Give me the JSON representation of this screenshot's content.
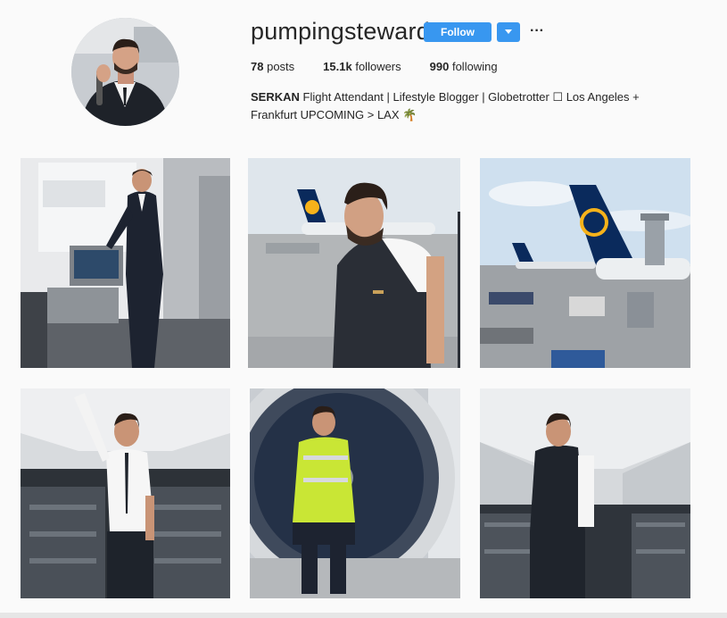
{
  "profile": {
    "username": "pumpingsteward",
    "follow_label": "Follow",
    "dropdown_icon": "chevron-down-icon",
    "more_icon": "more-options-icon",
    "more_glyph": "···"
  },
  "stats": {
    "posts_count": "78",
    "posts_label": "posts",
    "followers_count": "15.1k",
    "followers_label": "followers",
    "following_count": "990",
    "following_label": "following"
  },
  "bio": {
    "name": "SERKAN",
    "text": "Flight Attendant | Lifestyle Blogger | Globetrotter ☐ Los Angeles + Frankfurt UPCOMING > LAX",
    "emoji": "🌴"
  },
  "posts": [
    {
      "subject": "steward-first-class-cabin"
    },
    {
      "subject": "steward-apron-portrait"
    },
    {
      "subject": "lufthansa-tail-airport"
    },
    {
      "subject": "steward-empty-cabin-arm-raised"
    },
    {
      "subject": "steward-hi-vis-engine"
    },
    {
      "subject": "steward-cabin-aisle"
    }
  ],
  "colors": {
    "accent": "#3897f0",
    "background": "#fafafa",
    "text": "#262626"
  }
}
